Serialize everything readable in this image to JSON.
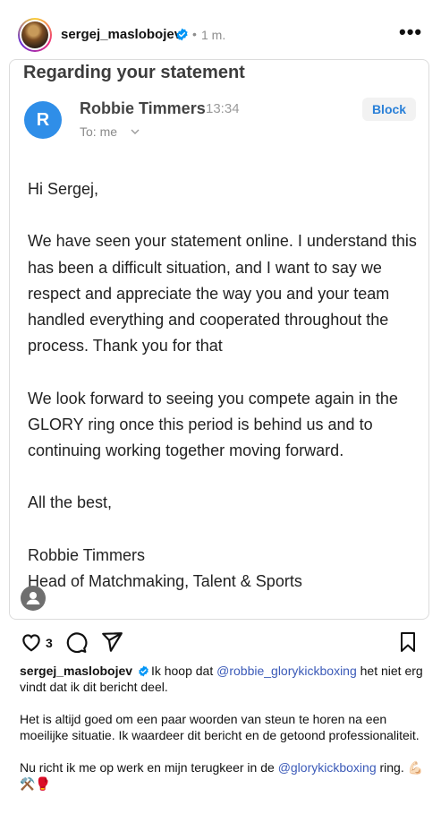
{
  "post": {
    "username": "sergej_maslobojev",
    "separator": "•",
    "time": "1 m.",
    "more_label": "•••"
  },
  "email": {
    "subject": "Regarding your statement",
    "sender_initial": "R",
    "sender_name": "Robbie Timmers",
    "sent_time": "13:34",
    "to_label": "To: me",
    "block_label": "Block",
    "greeting": "Hi Sergej,",
    "paragraph1": "We have seen your statement online. I understand this has been a difficult situation, and I want to say we respect and appreciate the way you and your team handled everything and cooperated throughout the process. Thank you for that",
    "paragraph2": "We look forward to seeing you compete again in the GLORY ring once this period is behind us and to continuing working together moving forward.",
    "closing": "All the best,",
    "signature_name": "Robbie Timmers",
    "signature_title": "Head of Matchmaking, Talent & Sports"
  },
  "actions": {
    "like_count": "3"
  },
  "caption": {
    "username": "sergej_maslobojev",
    "line1_pre": "Ik hoop dat ",
    "mention1": "@robbie_glorykickboxing",
    "line1_post": " het niet erg vindt dat ik dit bericht deel.",
    "para2": "Het is altijd goed om een paar woorden van steun te horen na een moeilijke situatie. Ik waardeer dit bericht en de getoond professionaliteit.",
    "para3_pre": "Nu richt ik me op werk en mijn terugkeer in de ",
    "mention2": "@glorykickboxing",
    "para3_post": " ring. 💪🏻⚒️🥊"
  },
  "colors": {
    "accent_blue": "#2f8ee8",
    "mention_blue": "#3b5ab8",
    "verified_blue": "#0095f6",
    "block_text": "#2a80d8"
  },
  "icons": [
    "verified-icon",
    "more-icon",
    "chevron-down-icon",
    "person-icon",
    "heart-icon",
    "comment-icon",
    "share-icon",
    "bookmark-icon"
  ]
}
